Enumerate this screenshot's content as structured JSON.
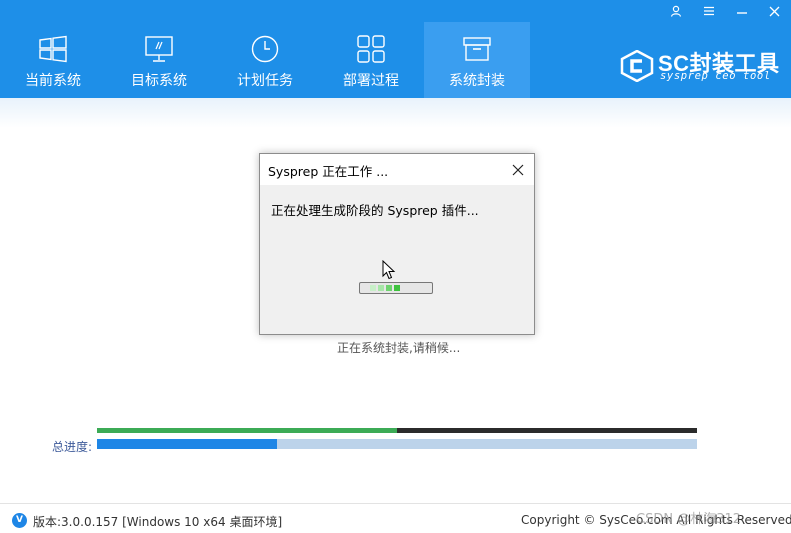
{
  "nav": {
    "items": [
      {
        "label": "当前系统",
        "icon": "windows-icon"
      },
      {
        "label": "目标系统",
        "icon": "monitor-icon"
      },
      {
        "label": "计划任务",
        "icon": "clock-icon"
      },
      {
        "label": "部署过程",
        "icon": "grid-icon"
      },
      {
        "label": "系统封装",
        "icon": "package-icon"
      }
    ],
    "active_index": 4
  },
  "window_controls": [
    "user-icon",
    "menu-icon",
    "minimize-icon",
    "close-icon"
  ],
  "logo": {
    "title": "SC封装工具",
    "subtitle": "sysprep ceo tool"
  },
  "dialog": {
    "title": "Sysprep 正在工作 ...",
    "message": "正在处理生成阶段的 Sysprep 插件...",
    "progress_segments_lit": 4
  },
  "status_text": "正在系统封装,请稍候...",
  "progress": {
    "task_fraction": 0.5,
    "total_label": "总进度:",
    "total_fraction": 0.3
  },
  "footer": {
    "version_icon": "V",
    "version": "版本:3.0.0.157 [Windows 10 x64 桌面环境]",
    "copyright": "Copyright © SysCeo.com All Rights Reserved.",
    "watermark": "CSDN @林海312"
  },
  "colors": {
    "header": "#1e8fe8",
    "nav_active": "#3a9ef0",
    "task_bar": "#3cab56",
    "total_bar": "#1e86e6",
    "total_track": "#bcd3ea"
  }
}
